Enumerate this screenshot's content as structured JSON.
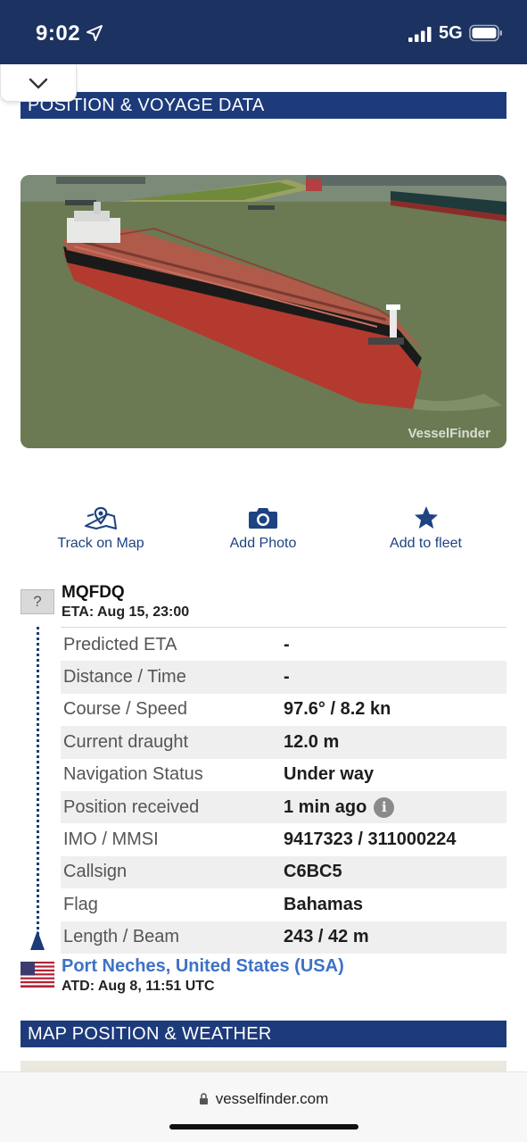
{
  "status_bar": {
    "time": "9:02",
    "network": "5G"
  },
  "sections": {
    "position_header": "POSITION & VOYAGE DATA",
    "map_header": "MAP POSITION & WEATHER"
  },
  "photo": {
    "watermark": "VesselFinder"
  },
  "actions": [
    {
      "label": "Track on Map",
      "icon": "map-pin-icon"
    },
    {
      "label": "Add Photo",
      "icon": "camera-icon"
    },
    {
      "label": "Add to fleet",
      "icon": "star-icon"
    }
  ],
  "voyage": {
    "destination_flag_placeholder": "?",
    "destination": "MQFDQ",
    "eta": "ETA: Aug 15, 23:00",
    "origin": "Port Neches, United States (USA)",
    "atd": "ATD: Aug 8, 11:51 UTC"
  },
  "details": [
    {
      "key": "Predicted ETA",
      "value": "-"
    },
    {
      "key": "Distance / Time",
      "value": "-"
    },
    {
      "key": "Course / Speed",
      "value": "97.6° / 8.2 kn"
    },
    {
      "key": "Current draught",
      "value": "12.0 m"
    },
    {
      "key": "Navigation Status",
      "value": "Under way"
    },
    {
      "key": "Position received",
      "value": "1 min ago",
      "info_icon": "i"
    },
    {
      "key": "IMO / MMSI",
      "value": "9417323 / 311000224"
    },
    {
      "key": "Callsign",
      "value": "C6BC5"
    },
    {
      "key": "Flag",
      "value": "Bahamas"
    },
    {
      "key": "Length / Beam",
      "value": "243 / 42 m"
    }
  ],
  "browser": {
    "url": "vesselfinder.com"
  },
  "colors": {
    "header_bg": "#1d3b7b",
    "status_bg": "#1c3260",
    "link": "#3e72c4",
    "action": "#1d4380"
  }
}
